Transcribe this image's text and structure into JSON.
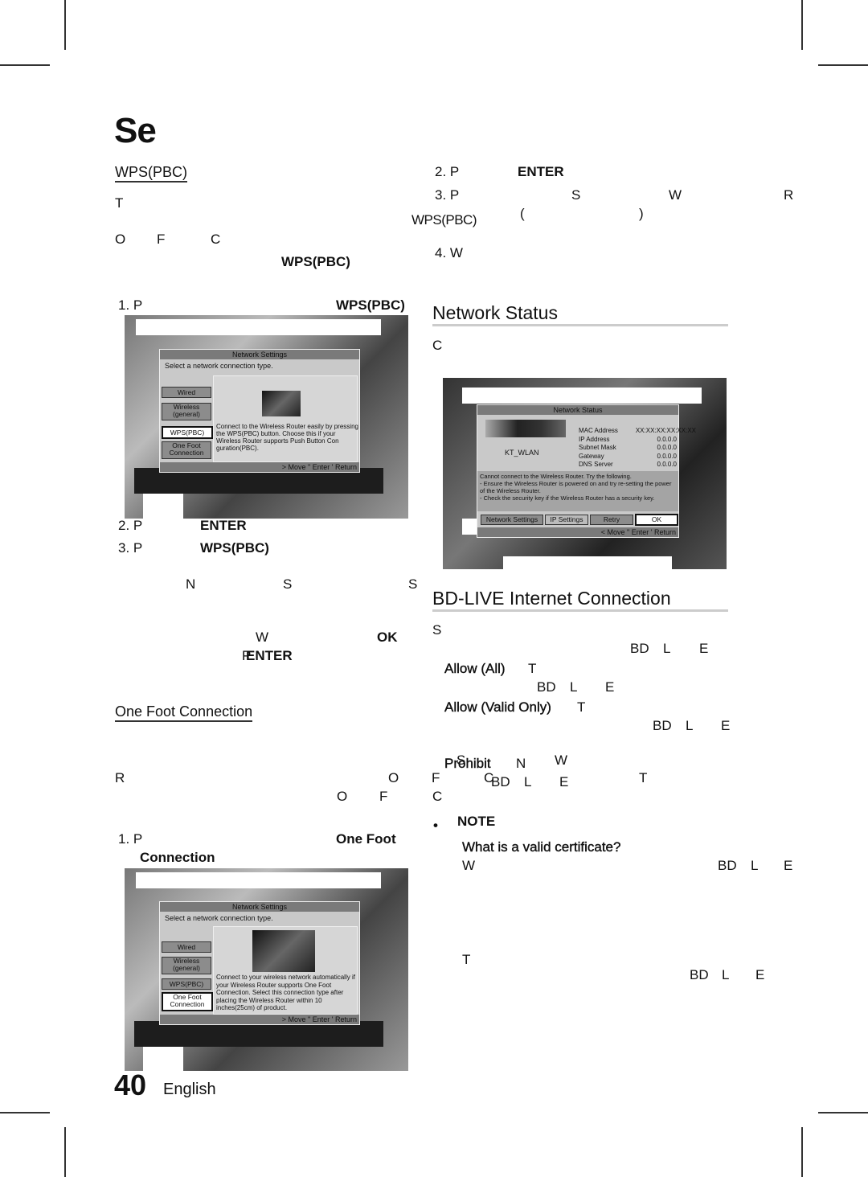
{
  "page": {
    "title": "Se",
    "page_number": "40",
    "language": "English"
  },
  "left": {
    "wps_heading": "WPS(PBC)",
    "t1": "T",
    "o": "O",
    "f": "F",
    "c": "C",
    "wps_bold": "WPS(PBC)",
    "step1_num": "1. P",
    "step1_bold": "WPS(PBC)",
    "step2_num": "2. P",
    "step2_bold": "ENTER",
    "step3_num": "3. P",
    "step3_bold": "WPS(PBC)",
    "n": "N",
    "s1": "S",
    "s2": "S",
    "w": "W",
    "ok": "OK",
    "p": "P",
    "enter": "ENTER",
    "ofc_heading": "One Foot Connection",
    "r": "R",
    "o2": "O",
    "f2": "F",
    "c2": "C",
    "o3": "O",
    "f3": "F",
    "c3": "C",
    "ofc_step1_num": "1. P",
    "ofc_step1_bold": "One Foot",
    "ofc_step1_bold2": "Connection"
  },
  "right": {
    "step2_num": "2. P",
    "step2_bold": "ENTER",
    "step3_num": "3. P",
    "s": "S",
    "w": "W",
    "r": "R",
    "wps": "WPS(PBC)",
    "paren_open": "(",
    "paren_close": ")",
    "step4_num": "4. W",
    "network_status_heading": "Network Status",
    "c": "C",
    "bdlive_heading": "BD-LIVE Internet Connection",
    "s2": "S",
    "bd": "BD",
    "l": "L",
    "e": "E",
    "allow_all": "Allow (All)",
    "t1": "T",
    "allow_valid": "Allow (Valid Only)",
    "t2": "T",
    "prohibit": "Prohibit",
    "n": "N",
    "s3": "S",
    "w2": "W",
    "t3": "T",
    "note_bullet": "•",
    "note": "NOTE",
    "note_q": "What is a valid certificate?",
    "w3": "W",
    "t4": "T"
  },
  "shot_wps": {
    "dialog_title": "Network Settings",
    "prompt": "Select a network connection type.",
    "options": [
      "Wired",
      "Wireless (general)",
      "WPS(PBC)",
      "One Foot Connection"
    ],
    "selected": "WPS(PBC)",
    "description": "Connect to the Wireless Router easily by pressing the WPS(PBC) button. Choose this if your Wireless Router supports Push Button Con guration(PBC).",
    "footer": "> Move \" Enter ' Return"
  },
  "shot_ofc": {
    "dialog_title": "Network Settings",
    "prompt": "Select a network connection type.",
    "options": [
      "Wired",
      "Wireless (general)",
      "WPS(PBC)",
      "One Foot Connection"
    ],
    "selected": "One Foot Connection",
    "description": "Connect to your wireless network automatically if your Wireless Router supports One Foot Connection. Select this connection type after placing the Wireless Router within 10 inches(25cm) of product.",
    "footer": "> Move \" Enter ' Return"
  },
  "shot_status": {
    "dialog_title": "Network Status",
    "ssid": "KT_WLAN",
    "fields": [
      {
        "label": "MAC Address",
        "value": "XX:XX:XX:XX:XX:XX"
      },
      {
        "label": "IP Address",
        "value": "0.0.0.0"
      },
      {
        "label": "Subnet Mask",
        "value": "0.0.0.0"
      },
      {
        "label": "Gateway",
        "value": "0.0.0.0"
      },
      {
        "label": "DNS Server",
        "value": "0.0.0.0"
      }
    ],
    "message": "Cannot connect to the Wireless Router. Try the following.\n- Ensure the Wireless Router is powered on and try re-setting the power of the Wireless Router.\n- Check the security key if the Wireless Router has a security key.",
    "buttons": [
      "Network Settings",
      "IP Settings",
      "Retry",
      "OK"
    ],
    "selected": "OK",
    "footer": "< Move \" Enter ' Return"
  }
}
